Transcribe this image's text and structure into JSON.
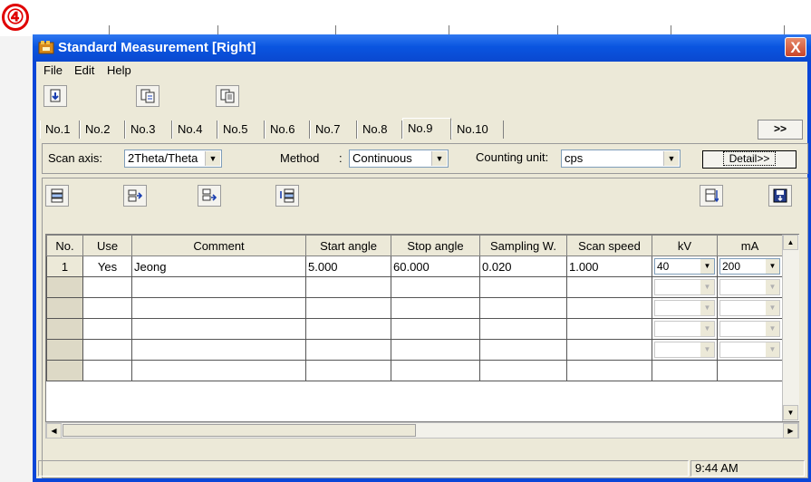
{
  "annotation": {
    "marker": "④"
  },
  "window": {
    "title": "Standard Measurement [Right]",
    "close_label": "X"
  },
  "menu": {
    "items": [
      "File",
      "Edit",
      "Help"
    ]
  },
  "toolbar1": {
    "buttons": [
      "open-icon",
      "copy-icon",
      "paste-icon"
    ]
  },
  "tabs": {
    "items": [
      "No.1",
      "No.2",
      "No.3",
      "No.4",
      "No.5",
      "No.6",
      "No.7",
      "No.8",
      "No.9",
      "No.10"
    ],
    "active": "No.9",
    "next_label": ">>"
  },
  "settings": {
    "scan_axis_label": "Scan axis:",
    "scan_axis_value": "2Theta/Theta",
    "method_label": "Method",
    "method_colon": ":",
    "method_value": "Continuous",
    "counting_unit_label": "Counting unit:",
    "counting_unit_value": "cps",
    "detail_label": "Detail>>"
  },
  "toolbar2": {
    "buttons": [
      "insert-row-icon",
      "move-row-right-icon",
      "copy-row-icon",
      "move-row-down-icon",
      "align-bottom-icon",
      "save-icon"
    ]
  },
  "table": {
    "columns": [
      "No.",
      "Use",
      "Comment",
      "Start angle",
      "Stop angle",
      "Sampling W.",
      "Scan speed",
      "kV",
      "mA"
    ],
    "rows": [
      {
        "no": "1",
        "use": "Yes",
        "comment": "Jeong",
        "start": "5.000",
        "stop": "60.000",
        "sampling": "0.020",
        "speed": "1.000",
        "kv": "40",
        "ma": "200"
      }
    ]
  },
  "status": {
    "time": "9:44 AM"
  },
  "colors": {
    "titlebar": "#0a55e0",
    "close": "#c8452a",
    "face": "#ece9d8",
    "marker": "#e00000"
  }
}
